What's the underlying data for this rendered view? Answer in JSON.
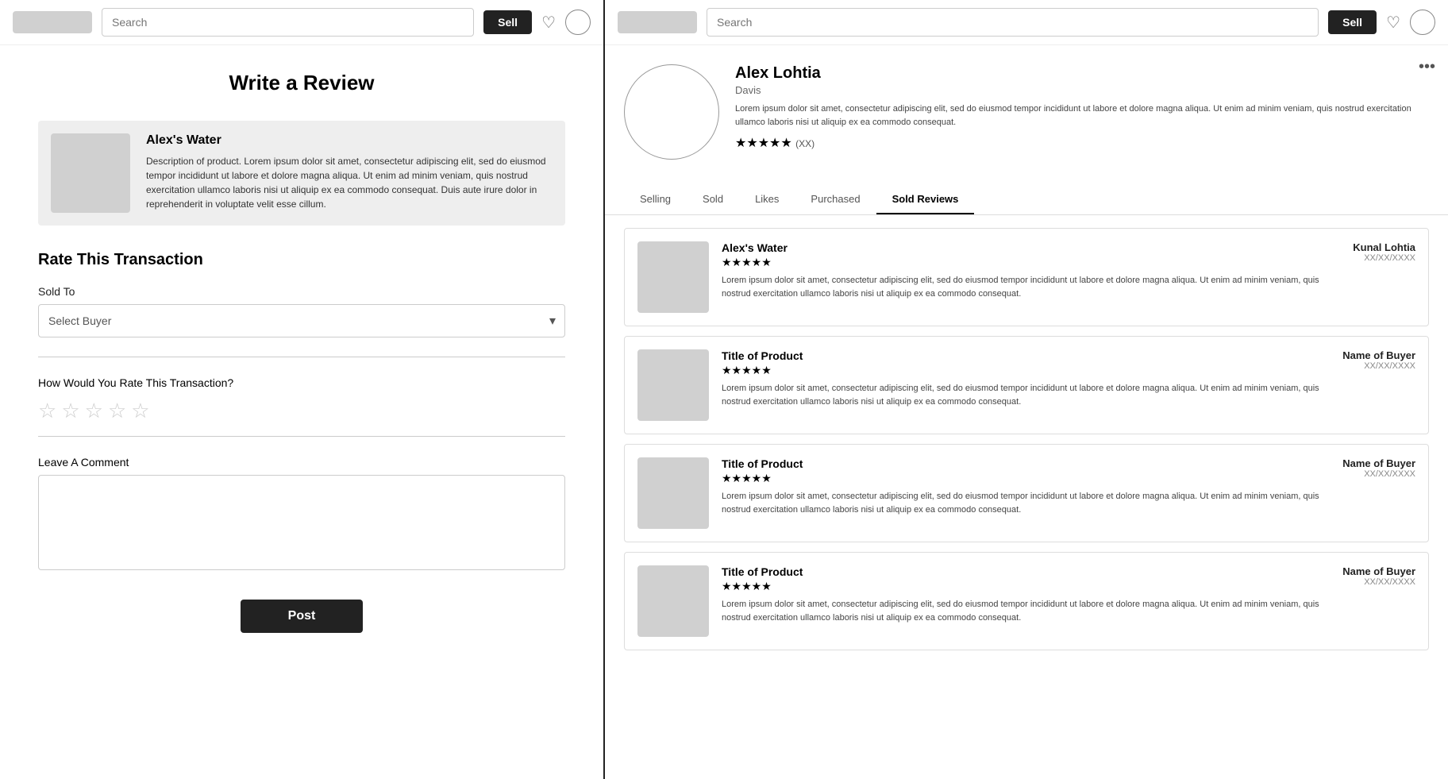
{
  "left": {
    "navbar": {
      "search_placeholder": "Search",
      "sell_label": "Sell"
    },
    "page_title": "Write a Review",
    "product": {
      "title": "Alex's Water",
      "description": "Description of product. Lorem ipsum dolor sit amet, consectetur adipiscing elit, sed do eiusmod tempor incididunt ut labore et dolore magna aliqua. Ut enim ad minim veniam, quis nostrud exercitation ullamco laboris nisi ut aliquip ex ea commodo consequat. Duis aute irure dolor in reprehenderit in voluptate velit esse cillum."
    },
    "rate_section": {
      "title": "Rate This Transaction",
      "sold_to_label": "Sold To",
      "select_buyer_placeholder": "Select Buyer",
      "rating_question": "How Would You Rate This Transaction?",
      "stars": [
        "☆",
        "☆",
        "☆",
        "☆",
        "☆"
      ],
      "comment_label": "Leave A Comment",
      "post_label": "Post"
    }
  },
  "right": {
    "navbar": {
      "search_placeholder": "Search",
      "sell_label": "Sell"
    },
    "profile": {
      "name": "Alex Lohtia",
      "location": "Davis",
      "bio": "Lorem ipsum dolor sit amet, consectetur adipiscing elit, sed do eiusmod tempor incididunt ut labore et dolore magna aliqua. Ut enim ad minim veniam, quis nostrud exercitation ullamco laboris nisi ut aliquip ex ea commodo consequat.",
      "stars": "★★★★★",
      "review_count": "(XX)",
      "more_icon": "•••"
    },
    "tabs": [
      {
        "label": "Selling",
        "active": false
      },
      {
        "label": "Sold",
        "active": false
      },
      {
        "label": "Likes",
        "active": false
      },
      {
        "label": "Purchased",
        "active": false
      },
      {
        "label": "Sold Reviews",
        "active": true
      }
    ],
    "reviews": [
      {
        "product_title": "Alex's Water",
        "stars": "★★★★★",
        "text": "Lorem ipsum dolor sit amet, consectetur adipiscing elit, sed do eiusmod tempor incididunt ut labore et dolore magna aliqua. Ut enim ad minim veniam, quis nostrud exercitation ullamco laboris nisi ut aliquip ex ea commodo consequat.",
        "buyer_name": "Kunal Lohtia",
        "date": "XX/XX/XXXX"
      },
      {
        "product_title": "Title of Product",
        "stars": "★★★★★",
        "text": "Lorem ipsum dolor sit amet, consectetur adipiscing elit, sed do eiusmod tempor incididunt ut labore et dolore magna aliqua. Ut enim ad minim veniam, quis nostrud exercitation ullamco laboris nisi ut aliquip ex ea commodo consequat.",
        "buyer_name": "Name of Buyer",
        "date": "XX/XX/XXXX"
      },
      {
        "product_title": "Title of Product",
        "stars": "★★★★★",
        "text": "Lorem ipsum dolor sit amet, consectetur adipiscing elit, sed do eiusmod tempor incididunt ut labore et dolore magna aliqua. Ut enim ad minim veniam, quis nostrud exercitation ullamco laboris nisi ut aliquip ex ea commodo consequat.",
        "buyer_name": "Name of Buyer",
        "date": "XX/XX/XXXX"
      },
      {
        "product_title": "Title of Product",
        "stars": "★★★★★",
        "text": "Lorem ipsum dolor sit amet, consectetur adipiscing elit, sed do eiusmod tempor incididunt ut labore et dolore magna aliqua. Ut enim ad minim veniam, quis nostrud exercitation ullamco laboris nisi ut aliquip ex ea commodo consequat.",
        "buyer_name": "Name of Buyer",
        "date": "XX/XX/XXXX"
      }
    ]
  }
}
